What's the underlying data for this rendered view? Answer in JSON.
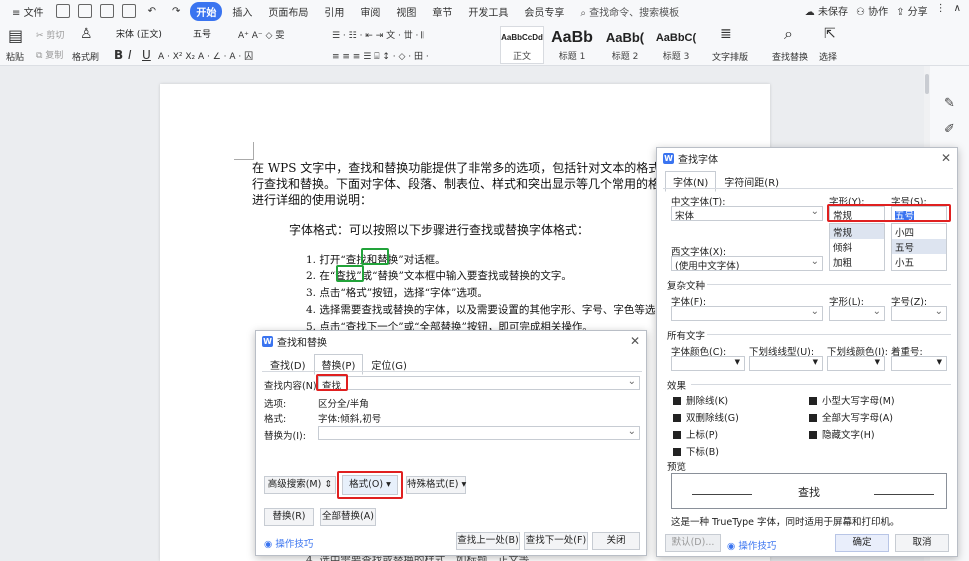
{
  "menu": {
    "file": "文件",
    "tabs": [
      "开始",
      "插入",
      "页面布局",
      "引用",
      "审阅",
      "视图",
      "章节",
      "开发工具",
      "会员专享"
    ],
    "search": "查找命令、搜索模板",
    "right": [
      "未保存",
      "协作",
      "分享"
    ]
  },
  "ribbon": {
    "paste": "粘贴",
    "cut": "剪切",
    "copy": "复制",
    "format_painter": "格式刷",
    "font_name": "宋体 (正文)",
    "font_size": "五号",
    "styles": [
      {
        "preview": "AaBbCcDd",
        "label": "正文"
      },
      {
        "preview": "AaBb",
        "label": "标题 1"
      },
      {
        "preview": "AaBb(",
        "label": "标题 2"
      },
      {
        "preview": "AaBbC(",
        "label": "标题 3"
      }
    ],
    "text_layout": "文字排版",
    "find_replace": "查找替换",
    "select": "选择"
  },
  "document": {
    "intro_lines": [
      "在 WPS 文字中，查找和替换功能提供了非常多的选项，包括针对文本的格式",
      "行查找和替换。下面对字体、段落、制表位、样式和突出显示等几个常用的格",
      "进行详细的使用说明："
    ],
    "font_heading": "字体格式：可以按照以下步骤进行查找或替换字体格式：",
    "steps": [
      "1.  打开“查找和替换”对话框。",
      "2.  在“查找”或“替换”文本框中输入要查找或替换的文字。",
      "3.  点击“格式”按钮，选择“字体”选项。",
      "4.  选择需要查找或替换的字体，以及需要设置的其他字形、字号、字色等选",
      "5.  点击“查找下一个”或“全部替换”按钮，即可完成相关操作。"
    ],
    "bottom_partial": "4.  选中需要查找或替换的样式，如标题、正文等。"
  },
  "find_dialog": {
    "title": "查找和替换",
    "tabs": [
      "查找(D)",
      "替换(P)",
      "定位(G)"
    ],
    "find_label": "查找内容(N):",
    "find_value": "查找",
    "options_label": "选项:",
    "options_value": "区分全/半角",
    "format_label": "格式:",
    "format_value": "字体:倾斜,初号",
    "replace_label": "替换为(I):",
    "replace_value": "",
    "advanced": "高级搜索(M)",
    "format_btn": "格式(O)",
    "special_btn": "特殊格式(E)",
    "replace_btn": "替换(R)",
    "replace_all_btn": "全部替换(A)",
    "tips": "操作技巧",
    "find_prev": "查找上一处(B)",
    "find_next": "查找下一处(F)",
    "close": "关闭"
  },
  "font_dialog": {
    "title": "查找字体",
    "tabs": [
      "字体(N)",
      "字符间距(R)"
    ],
    "cn_font_label": "中文字体(T):",
    "cn_font_value": "宋体",
    "style_label": "字形(Y):",
    "style_value": "常规",
    "style_options": [
      "常规",
      "倾斜",
      "加粗"
    ],
    "size_label": "字号(S):",
    "size_value": "五号",
    "size_options": [
      "小四",
      "五号",
      "小五"
    ],
    "west_font_label": "西文字体(X):",
    "west_font_value": "(使用中文字体)",
    "complex_section": "复杂文种",
    "complex_font_label": "字体(F):",
    "complex_style_label": "字形(L):",
    "complex_size_label": "字号(Z):",
    "all_text_section": "所有文字",
    "font_color_label": "字体颜色(C):",
    "underline_label": "下划线线型(U):",
    "underline_color_label": "下划线颜色(I):",
    "emphasis_label": "着重号:",
    "effects_section": "效果",
    "effects_left": [
      "删除线(K)",
      "双删除线(G)",
      "上标(P)",
      "下标(B)"
    ],
    "effects_right": [
      "小型大写字母(M)",
      "全部大写字母(A)",
      "隐藏文字(H)"
    ],
    "preview_section": "预览",
    "preview_text": "查找",
    "note": "这是一种 TrueType 字体，同时适用于屏幕和打印机。",
    "default_btn": "默认(D)...",
    "tips": "操作技巧",
    "ok": "确定",
    "cancel": "取消"
  }
}
